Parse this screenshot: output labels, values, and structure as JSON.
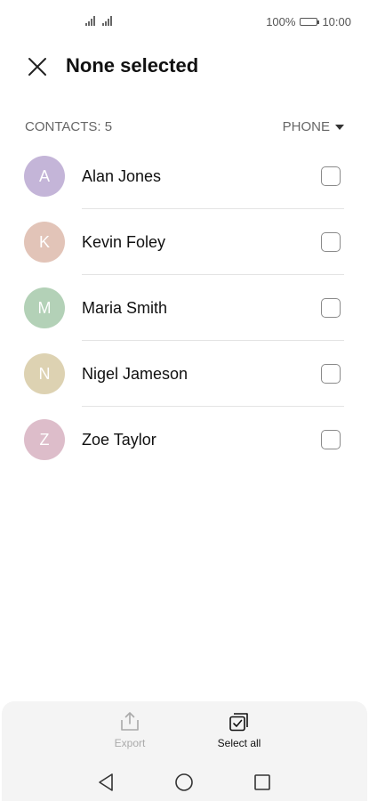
{
  "status_bar": {
    "battery": "100%",
    "time": "10:00"
  },
  "header": {
    "title": "None selected"
  },
  "list_header": {
    "count": "CONTACTS: 5",
    "filter": "PHONE"
  },
  "contacts": [
    {
      "initial": "A",
      "name": "Alan Jones",
      "color": "#c4b5d8"
    },
    {
      "initial": "K",
      "name": "Kevin Foley",
      "color": "#e2c4b8"
    },
    {
      "initial": "M",
      "name": "Maria Smith",
      "color": "#b3d1b7"
    },
    {
      "initial": "N",
      "name": "Nigel Jameson",
      "color": "#ddd2b2"
    },
    {
      "initial": "Z",
      "name": "Zoe Taylor",
      "color": "#ddbdca"
    }
  ],
  "actions": {
    "export": "Export",
    "select_all": "Select all"
  },
  "icons": [
    "signal-icon",
    "battery-icon",
    "close-icon",
    "caret-down-icon",
    "export-icon",
    "select-all-icon",
    "back-icon",
    "home-icon",
    "recents-icon"
  ]
}
